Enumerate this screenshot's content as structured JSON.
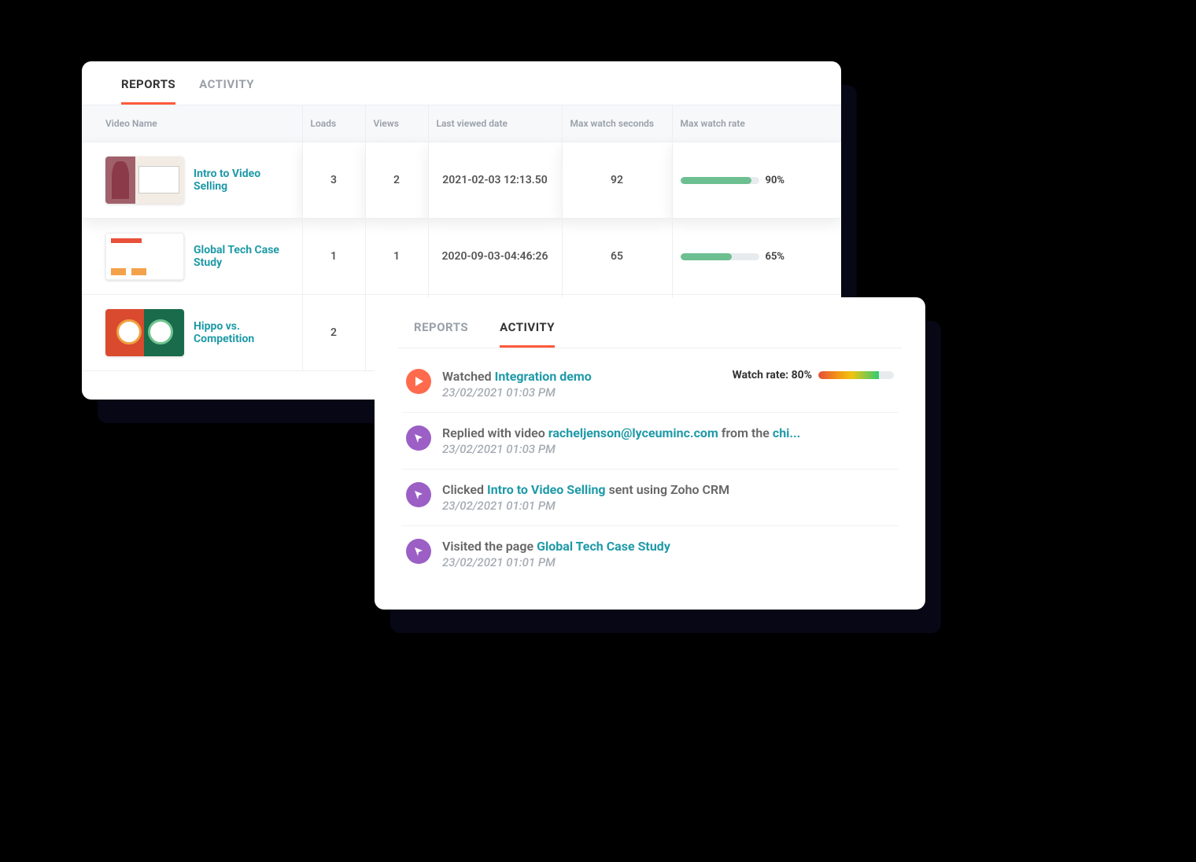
{
  "reports": {
    "tabs": {
      "reports": "REPORTS",
      "activity": "ACTIVITY"
    },
    "headers": {
      "video_name": "Video Name",
      "loads": "Loads",
      "views": "Views",
      "last_viewed": "Last viewed date",
      "max_seconds": "Max watch seconds",
      "max_rate": "Max watch rate"
    },
    "rows": [
      {
        "name": "Intro to Video Selling",
        "loads": "3",
        "views": "2",
        "last_viewed": "2021-02-03 12:13.50",
        "max_seconds": "92",
        "max_rate_pct": 90,
        "max_rate_label": "90%"
      },
      {
        "name": "Global Tech Case Study",
        "loads": "1",
        "views": "1",
        "last_viewed": "2020-09-03-04:46:26",
        "max_seconds": "65",
        "max_rate_pct": 65,
        "max_rate_label": "65%"
      },
      {
        "name": "Hippo vs. Competition",
        "loads": "2",
        "views": "",
        "last_viewed": "",
        "max_seconds": "",
        "max_rate_pct": 0,
        "max_rate_label": ""
      }
    ]
  },
  "activity": {
    "tabs": {
      "reports": "REPORTS",
      "activity": "ACTIVITY"
    },
    "items": [
      {
        "kind": "watched",
        "prefix": "Watched",
        "link": "Integration demo",
        "suffix": "",
        "time": "23/02/2021 01:03 PM",
        "watch_rate_label": "Watch rate: 80%",
        "watch_rate_pct": 80
      },
      {
        "kind": "replied",
        "prefix": "Replied with video",
        "link": "racheljenson@lyceuminc.com",
        "mid": " from the ",
        "link2": "chi...",
        "time": "23/02/2021 01:03 PM"
      },
      {
        "kind": "clicked",
        "prefix": "Clicked",
        "link": "Intro to Video Selling",
        "suffix": " sent using Zoho CRM",
        "time": "23/02/2021 01:01 PM"
      },
      {
        "kind": "visited",
        "prefix": "Visited the page",
        "link": "Global Tech Case Study",
        "suffix": "",
        "time": "23/02/2021 01:01 PM"
      }
    ]
  }
}
